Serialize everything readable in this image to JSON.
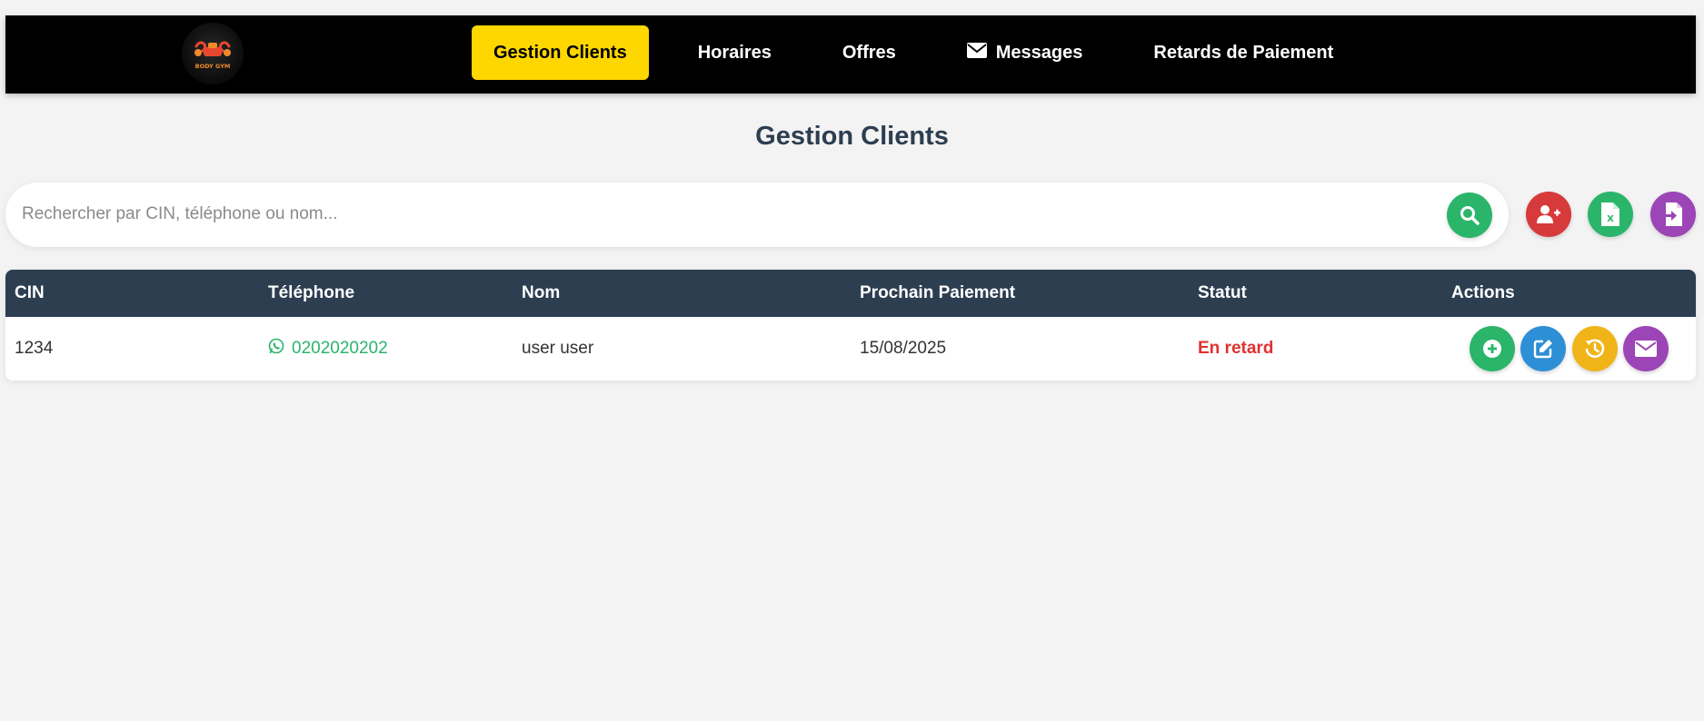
{
  "nav": {
    "logo_text": "BODY GYM",
    "items": [
      {
        "label": "Gestion Clients",
        "active": true
      },
      {
        "label": "Horaires",
        "active": false
      },
      {
        "label": "Offres",
        "active": false
      },
      {
        "label": "Messages",
        "active": false,
        "icon": "envelope-icon"
      },
      {
        "label": "Retards de Paiement",
        "active": false
      }
    ]
  },
  "page": {
    "title": "Gestion Clients"
  },
  "search": {
    "placeholder": "Rechercher par CIN, téléphone ou nom...",
    "value": "",
    "buttons": {
      "search": {
        "icon": "search-icon",
        "color": "#2ab56a"
      },
      "add_user": {
        "icon": "user-plus-icon",
        "color": "#d63a3a"
      },
      "export_excel": {
        "icon": "file-excel-icon",
        "color": "#2ab56a"
      },
      "import": {
        "icon": "file-import-icon",
        "color": "#9b45b6"
      }
    }
  },
  "table": {
    "columns": [
      "CIN",
      "Téléphone",
      "Nom",
      "Prochain Paiement",
      "Statut",
      "Actions"
    ],
    "rows": [
      {
        "cin": "1234",
        "telephone": "0202020202",
        "nom": "user user",
        "prochain_paiement": "15/08/2025",
        "statut": "En retard",
        "actions": [
          "plus-circle-icon",
          "edit-icon",
          "history-icon",
          "envelope-icon"
        ]
      }
    ]
  },
  "colors": {
    "navbar_bg": "#000000",
    "active_nav": "#ffd700",
    "header_bg": "#2c3e50",
    "status_late": "#e03131",
    "whatsapp_green": "#2ab56a",
    "page_bg": "#f3f3f3"
  }
}
